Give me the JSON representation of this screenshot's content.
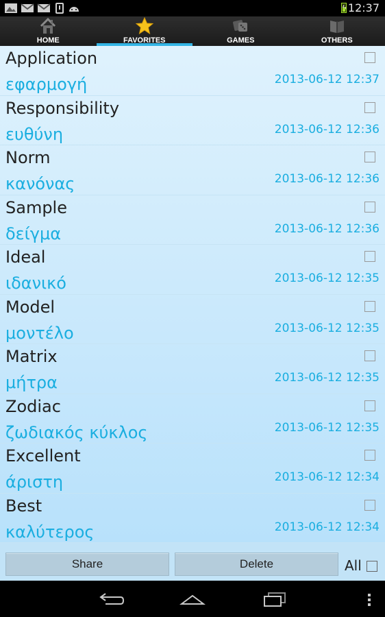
{
  "status_bar": {
    "time": "12:37",
    "icons": [
      "gallery-icon",
      "gmail-icon",
      "gmail-icon",
      "usb-debug-icon",
      "android-icon",
      "battery-charging-icon"
    ]
  },
  "tabs": [
    {
      "label": "HOME",
      "icon": "home-icon",
      "active": false
    },
    {
      "label": "FAVORITES",
      "icon": "star-icon",
      "active": true
    },
    {
      "label": "GAMES",
      "icon": "dice-icon",
      "active": false
    },
    {
      "label": "OTHERS",
      "icon": "book-icon",
      "active": false
    }
  ],
  "favorites": [
    {
      "word": "Application",
      "translation": "εφαρμογή",
      "date": "2013-06-12 12:37"
    },
    {
      "word": "Responsibility",
      "translation": "ευθύνη",
      "date": "2013-06-12 12:36"
    },
    {
      "word": "Norm",
      "translation": "κανόνας",
      "date": "2013-06-12 12:36"
    },
    {
      "word": "Sample",
      "translation": "δείγμα",
      "date": "2013-06-12 12:36"
    },
    {
      "word": "Ideal",
      "translation": "ιδανικό",
      "date": "2013-06-12 12:35"
    },
    {
      "word": "Model",
      "translation": "μοντέλο",
      "date": "2013-06-12 12:35"
    },
    {
      "word": "Matrix",
      "translation": "μήτρα",
      "date": "2013-06-12 12:35"
    },
    {
      "word": "Zodiac",
      "translation": "ζωδιακός κύκλος",
      "date": "2013-06-12 12:35"
    },
    {
      "word": "Excellent",
      "translation": "άριστη",
      "date": "2013-06-12 12:34"
    },
    {
      "word": "Best",
      "translation": "καλύτερος",
      "date": "2013-06-12 12:34"
    }
  ],
  "actions": {
    "share_label": "Share",
    "delete_label": "Delete",
    "all_label": "All"
  },
  "colors": {
    "accent": "#33b5e5",
    "translation_text": "#1aaee0",
    "list_background_top": "#dff2fd",
    "list_background_bottom": "#b8e1fb"
  },
  "nav_bar": [
    "back-icon",
    "home-icon",
    "recents-icon"
  ]
}
